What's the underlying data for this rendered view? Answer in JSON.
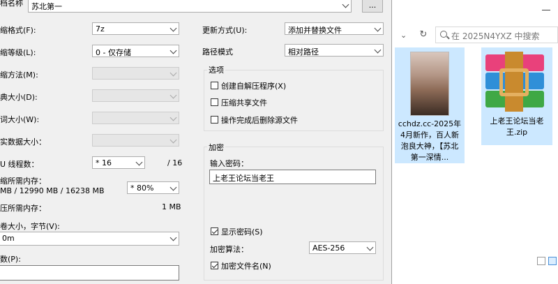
{
  "dialog": {
    "archive_path_label": "档名称",
    "archive_path_value": "苏北第一",
    "browse_label": "...",
    "format_label": "缩格式(F):",
    "format_value": "7z",
    "level_label": "缩等级(L):",
    "level_value": "0 - 仅存储",
    "method_label": "缩方法(M):",
    "dict_label": "典大小(D):",
    "word_label": "词大小(W):",
    "solid_label": "实数据大小：",
    "threads_label": "U 线程数：",
    "threads_value": "* 16",
    "threads_max": "/ 16",
    "mem_compress_label": "缩所需内存：",
    "mem_compress_detail": "MB / 12990 MB / 16238 MB",
    "mem_percent_value": "* 80%",
    "mem_decompress_label": "压所需内存：",
    "mem_decompress_value": "1 MB",
    "split_label": "卷大小，字节(V):",
    "split_value": "0m",
    "params_label": "数(P):",
    "update_label": "更新方式(U):",
    "update_value": "添加并替换文件",
    "path_mode_label": "路径模式",
    "path_mode_value": "相对路径",
    "options_title": "选项",
    "opt_sfx": "创建自解压程序(X)",
    "opt_shared": "压缩共享文件",
    "opt_delete": "操作完成后删除源文件",
    "encryption_title": "加密",
    "password_label": "输入密码：",
    "password_value": "上老王论坛当老王",
    "show_password": "显示密码(S)",
    "enc_method_label": "加密算法：",
    "enc_method_value": "AES-256",
    "encrypt_names": "加密文件名(N)"
  },
  "explorer": {
    "search_placeholder": "在 2025N4YXZ 中搜索",
    "files": [
      {
        "name": "cchdz.cc-2025年4月新作，百人新泡良大神，【苏北第一深情...",
        "icon": "image-thumbnail"
      },
      {
        "name": "上老王论坛当老王.zip",
        "icon": "winrar-archive-icon"
      }
    ]
  },
  "colors": {
    "dialog_bg": "#f0f0f0",
    "selection": "#cce8ff"
  }
}
